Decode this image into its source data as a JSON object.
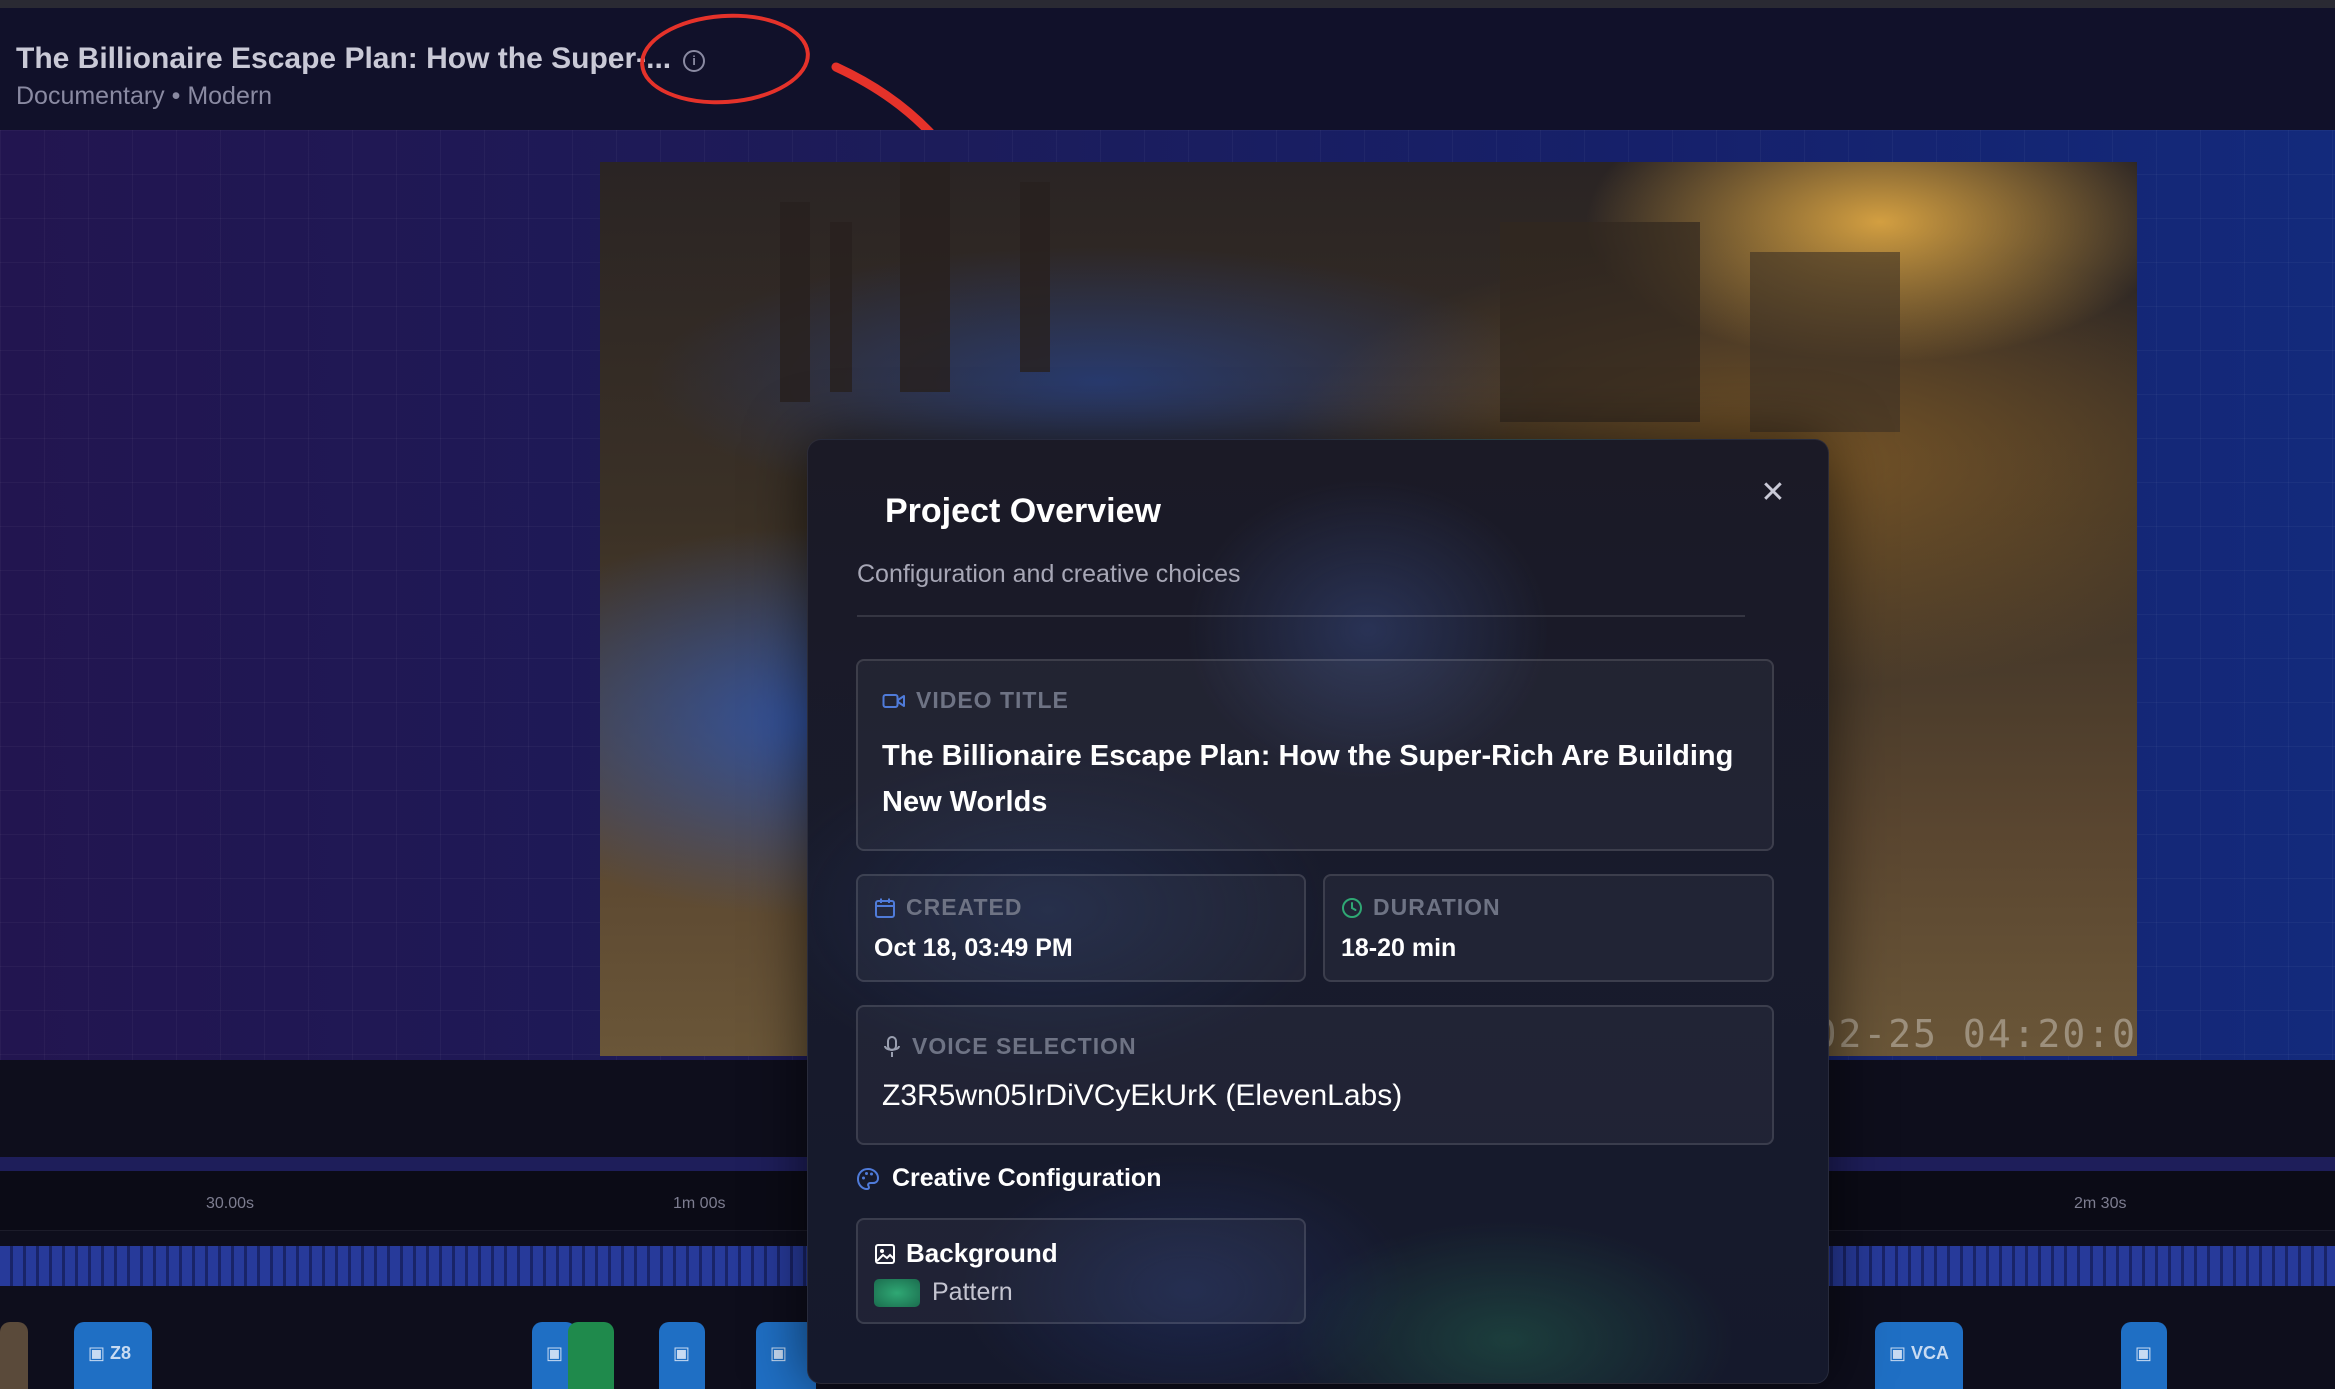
{
  "header": {
    "title": "The Billionaire Escape Plan: How the Super-...",
    "subtitle": "Documentary • Modern",
    "info_icon": "info-icon"
  },
  "video": {
    "timestamp": "2-02-25 04:20:0"
  },
  "timeline": {
    "ruler_labels": [
      "30.00s",
      "1m 00s",
      "2m 30s"
    ],
    "clip_labels": {
      "c1": "Z8",
      "c2": "VCA"
    }
  },
  "modal": {
    "title": "Project Overview",
    "subtitle": "Configuration and creative choices",
    "close_icon": "close-icon",
    "video_title_label": "VIDEO TITLE",
    "video_title_value": "The Billionaire Escape Plan: How the Super-Rich Are Building New Worlds",
    "created_label": "CREATED",
    "created_value": "Oct 18, 03:49 PM",
    "duration_label": "DURATION",
    "duration_value": "18-20 min",
    "voice_label": "VOICE SELECTION",
    "voice_value": "Z3R5wn05IrDiVCyEkUrK (ElevenLabs)",
    "creative_heading": "Creative Configuration",
    "background_label": "Background",
    "background_value": "Pattern"
  },
  "colors": {
    "annotation": "#e5322a",
    "accent_blue": "#4f7bd9",
    "accent_green": "#2fa874"
  }
}
